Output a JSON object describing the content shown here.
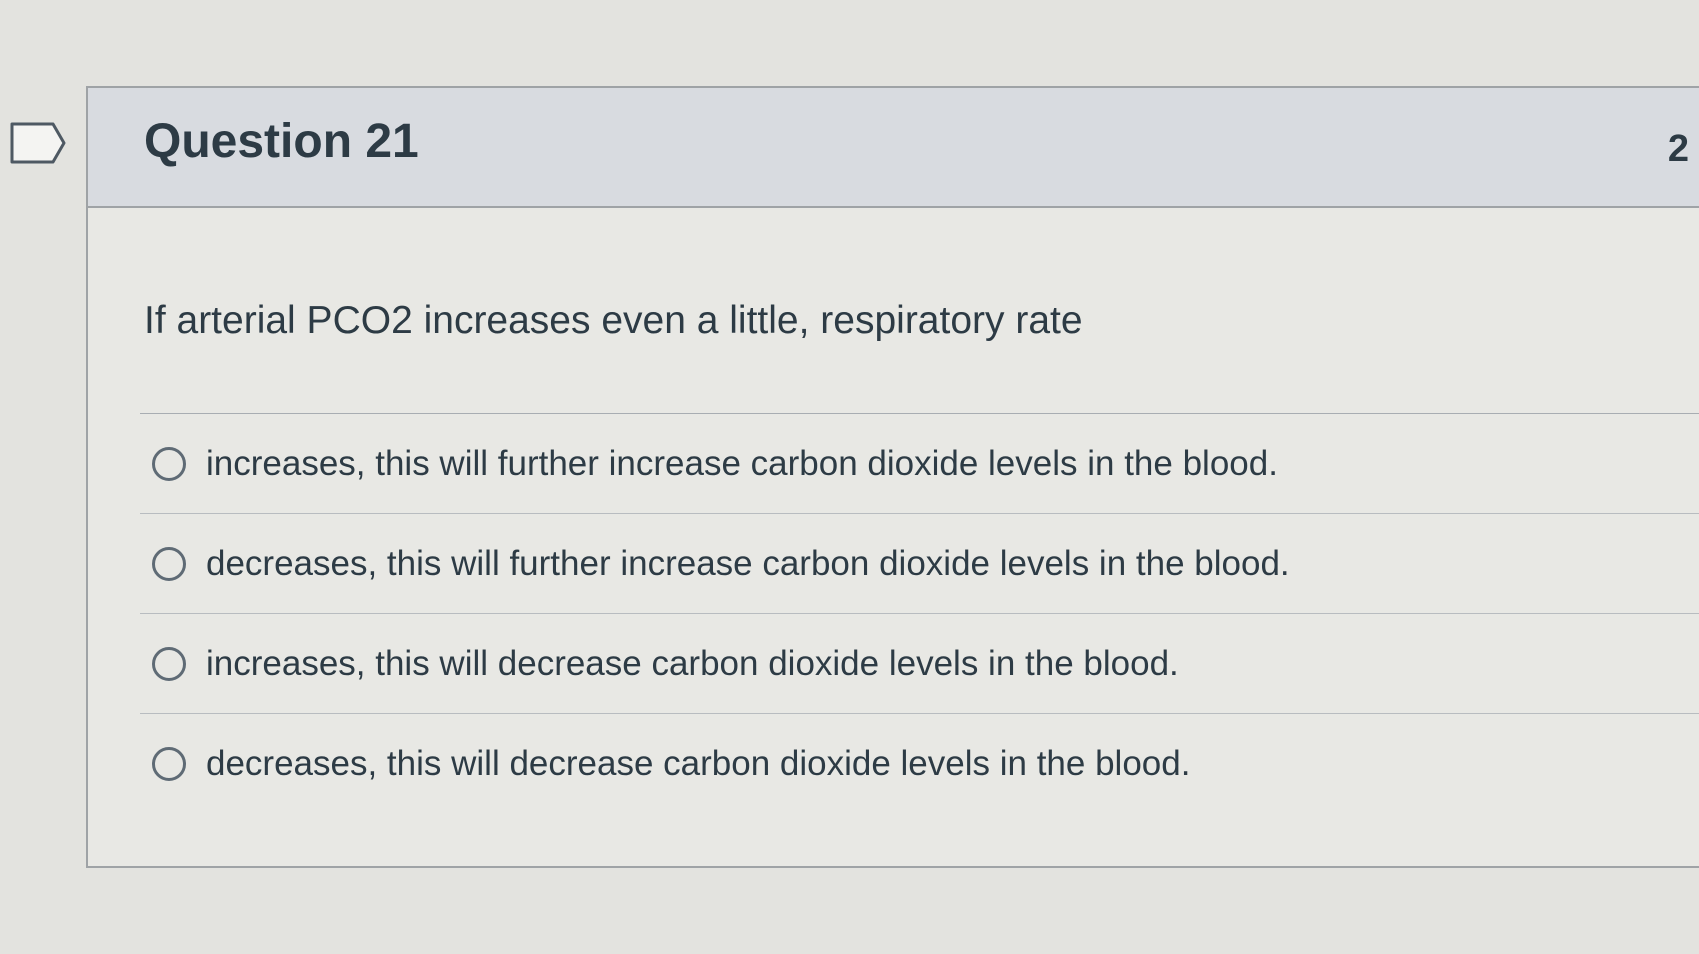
{
  "question": {
    "title": "Question 21",
    "points": "2",
    "prompt": "If arterial PCO2 increases even a little, respiratory rate",
    "flag_icon": "flag-tab-icon"
  },
  "answers": [
    {
      "label": "increases, this will further increase carbon dioxide levels in the blood."
    },
    {
      "label": "decreases, this will further increase carbon dioxide levels in the blood."
    },
    {
      "label": "increases, this will decrease carbon dioxide levels in the blood."
    },
    {
      "label": "decreases, this will decrease carbon dioxide levels in the blood."
    }
  ],
  "colors": {
    "background": "#e3e3df",
    "header": "#d8dbe0",
    "text": "#2d3b45",
    "border": "#9fa3a6"
  }
}
